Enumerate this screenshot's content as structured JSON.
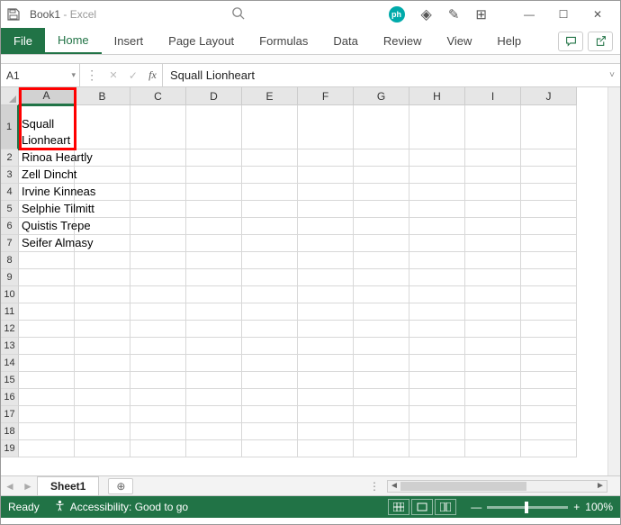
{
  "title": {
    "doc": "Book1",
    "sep": "  -  ",
    "app": "Excel"
  },
  "tabs": {
    "file": "File",
    "home": "Home",
    "insert": "Insert",
    "page_layout": "Page Layout",
    "formulas": "Formulas",
    "data": "Data",
    "review": "Review",
    "view": "View",
    "help": "Help"
  },
  "namebox": "A1",
  "formula": "Squall Lionheart",
  "columns": [
    "A",
    "B",
    "C",
    "D",
    "E",
    "F",
    "G",
    "H",
    "I",
    "J"
  ],
  "rows": [
    "1",
    "2",
    "3",
    "4",
    "5",
    "6",
    "7",
    "8",
    "9",
    "10",
    "11",
    "12",
    "13",
    "14",
    "15",
    "16",
    "17",
    "18",
    "19"
  ],
  "cells": {
    "A1": "Squall Lionheart",
    "A2": "Rinoa Heartly",
    "A3": "Zell Dincht",
    "A4": "Irvine Kinneas",
    "A5": "Selphie Tilmitt",
    "A6": "Quistis Trepe",
    "A7": "Seifer Almasy"
  },
  "sheet": {
    "name": "Sheet1"
  },
  "status": {
    "ready": "Ready",
    "accessibility": "Accessibility: Good to go",
    "zoom": "100%"
  },
  "glyphs": {
    "minus": "—",
    "square": "☐",
    "close": "✕",
    "diamond": "◈",
    "pencil": "✎",
    "window": "⊞",
    "check": "✓",
    "fx": "fx",
    "dots": "⋮",
    "dd": "▾",
    "expand": "˅",
    "prev": "◄",
    "next": "►",
    "plus": "⊕",
    "comment": "💬",
    "share": "↗",
    "personicon": "👤",
    "left": "◄",
    "right": "►",
    "ph": "ph"
  }
}
